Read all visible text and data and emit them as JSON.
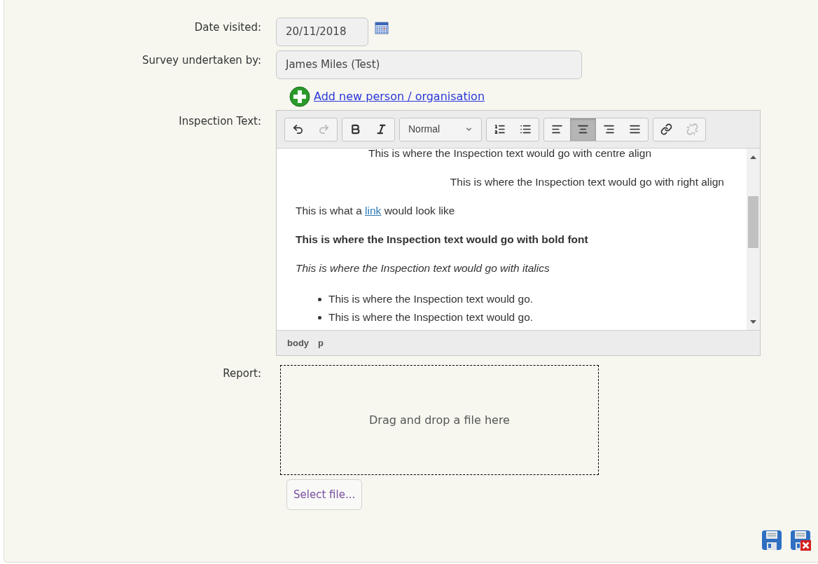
{
  "date_visited": {
    "label": "Date visited:",
    "value": "20/11/2018"
  },
  "survey_by": {
    "label": "Survey undertaken by:",
    "value": "James Miles (Test)",
    "add_link": "Add new person / organisation"
  },
  "inspection": {
    "label": "Inspection Text:",
    "toolbar": [
      {
        "buttons": [
          {
            "kind": "undo",
            "disabled": false
          },
          {
            "kind": "redo",
            "disabled": true
          }
        ]
      },
      {
        "buttons": [
          {
            "kind": "bold",
            "disabled": false
          },
          {
            "kind": "italic",
            "disabled": false
          }
        ]
      },
      {
        "format": "Normal"
      },
      {
        "buttons": [
          {
            "kind": "ordered-list",
            "disabled": false
          },
          {
            "kind": "bullet-list",
            "disabled": false
          }
        ]
      },
      {
        "buttons": [
          {
            "kind": "align-left",
            "disabled": false,
            "selected": false
          },
          {
            "kind": "align-center",
            "disabled": false,
            "selected": true
          },
          {
            "kind": "align-right",
            "disabled": false,
            "selected": false
          },
          {
            "kind": "align-justify",
            "disabled": false,
            "selected": false
          }
        ]
      },
      {
        "buttons": [
          {
            "kind": "link",
            "disabled": false
          },
          {
            "kind": "unlink",
            "disabled": true
          }
        ]
      }
    ],
    "content": [
      {
        "kind": "centered",
        "text": "This is where the Inspection text would go with centre align"
      },
      {
        "kind": "right",
        "text": "This is where the Inspection text would go with right align"
      },
      {
        "kind": "link-paragraph",
        "before": "This is what a ",
        "link": "link",
        "after": " would look like"
      },
      {
        "kind": "bold",
        "text": "This is where the Inspection text would go with bold font"
      },
      {
        "kind": "italic",
        "text": "This is where the Inspection text would go with italics"
      },
      {
        "kind": "bullets",
        "items": [
          "This is where the Inspection text would go.",
          "This is where the Inspection text would go."
        ]
      }
    ],
    "path": [
      "body",
      "p"
    ]
  },
  "report": {
    "label": "Report:",
    "drop_text": "Drag and drop a file here",
    "select_button": "Select file..."
  }
}
